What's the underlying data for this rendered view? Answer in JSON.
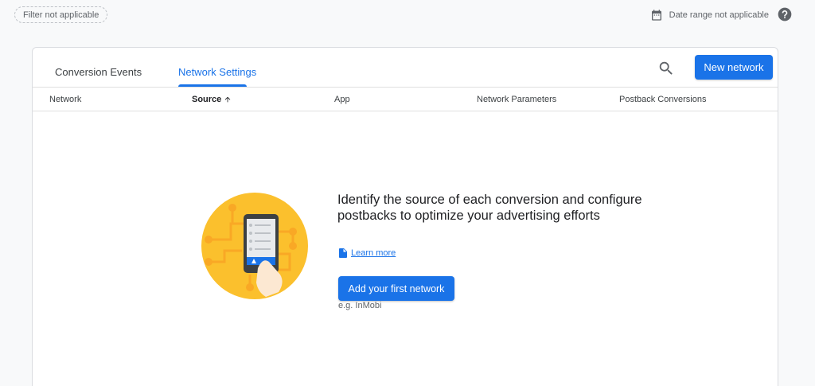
{
  "topbar": {
    "filter_label": "Filter not applicable",
    "date_range_label": "Date range not applicable"
  },
  "tabs": [
    {
      "label": "Conversion Events",
      "active": false
    },
    {
      "label": "Network Settings",
      "active": true
    }
  ],
  "toolbar": {
    "new_network_label": "New network"
  },
  "table": {
    "columns": [
      {
        "label": "Network"
      },
      {
        "label": "Source",
        "sorted": "ascending"
      },
      {
        "label": "App"
      },
      {
        "label": "Network Parameters"
      },
      {
        "label": "Postback Conversions"
      }
    ]
  },
  "empty_state": {
    "title": "Identify the source of each conversion and configure postbacks to optimize your advertising efforts",
    "learn_more_label": "Learn more",
    "add_button_label": "Add your first network",
    "hint": "e.g. InMobi"
  },
  "colors": {
    "accent": "#1a73e8",
    "illustration_yellow": "#fbc02d",
    "illustration_orange": "#f9a825"
  }
}
